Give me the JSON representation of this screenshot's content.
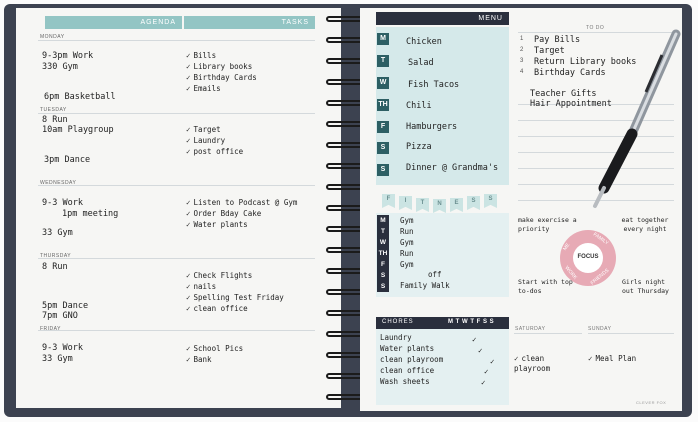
{
  "left_page": {
    "agenda_header": "AGENDA",
    "tasks_header": "TASKS",
    "days": [
      {
        "label": "MONDAY",
        "entries": [
          "9-3pm Work",
          "330 Gym",
          "6pm Basketball"
        ]
      },
      {
        "label": "TUESDAY",
        "entries": [
          "8 Run",
          "10am Playgroup",
          "3pm Dance"
        ]
      },
      {
        "label": "WEDNESDAY",
        "entries": [
          "9-3 Work",
          "1pm meeting",
          "33 Gym"
        ]
      },
      {
        "label": "THURSDAY",
        "entries": [
          "8 Run",
          "5pm Dance",
          "7pm GNO"
        ]
      },
      {
        "label": "FRIDAY",
        "entries": [
          "9-3 Work",
          "33 Gym"
        ]
      }
    ],
    "tasks": [
      [
        "Bills",
        "Library books",
        "Birthday Cards",
        "Emails"
      ],
      [
        "Target",
        "Laundry",
        "post office"
      ],
      [
        "Listen to Podcast @ Gym",
        "Order Bday Cake",
        "Water plants"
      ],
      [
        "Check Flights",
        "nails",
        "Spelling Test Friday",
        "clean office"
      ],
      [
        "School Pics",
        "Bank"
      ]
    ]
  },
  "right_page": {
    "menu_header": "MENU",
    "menu": [
      {
        "day": "M",
        "item": "Chicken"
      },
      {
        "day": "T",
        "item": "Salad"
      },
      {
        "day": "W",
        "item": "Fish Tacos"
      },
      {
        "day": "TH",
        "item": "Chili"
      },
      {
        "day": "F",
        "item": "Hamburgers"
      },
      {
        "day": "S",
        "item": "Pizza"
      },
      {
        "day": "S",
        "item": "Dinner @ Grandma's"
      }
    ],
    "fitness_banner": [
      "F",
      "I",
      "T",
      "N",
      "E",
      "S",
      "S"
    ],
    "fitness": [
      {
        "day": "M",
        "item": "Gym"
      },
      {
        "day": "T",
        "item": "Run"
      },
      {
        "day": "W",
        "item": "Gym"
      },
      {
        "day": "TH",
        "item": "Run"
      },
      {
        "day": "F",
        "item": "Gym"
      },
      {
        "day": "S",
        "item": "off"
      },
      {
        "day": "S",
        "item": "Family Walk"
      }
    ],
    "chores_header": "CHORES",
    "chores_days": "M T W T F S S",
    "chores": [
      "Laundry",
      "Water plants",
      "clean playroom",
      "clean office",
      "Wash sheets"
    ],
    "todo_header": "TO DO",
    "todo": [
      "Pay Bills",
      "Target",
      "Return Library books",
      "Birthday Cards"
    ],
    "todo_numbers": [
      "1",
      "2",
      "3",
      "4"
    ],
    "todo_extra": [
      "Teacher Gifts",
      "Hair Appointment"
    ],
    "focus_label": "FOCUS",
    "focus_words": [
      "ME",
      "FAMILY",
      "WORK",
      "FRIENDS"
    ],
    "notes": [
      "make exercise a priority",
      "eat together every night",
      "Start with top to-dos",
      "Girls night out Thursday"
    ],
    "saturday_label": "SATURDAY",
    "sunday_label": "SUNDAY",
    "saturday_entry": "clean playroom",
    "sunday_entry": "Meal Plan",
    "footer": "CLEVER FOX"
  },
  "colors": {
    "teal": "#93c5c4",
    "navy": "#2a2f3d",
    "pink": "#e7aab5",
    "page": "#f6f6f4"
  }
}
